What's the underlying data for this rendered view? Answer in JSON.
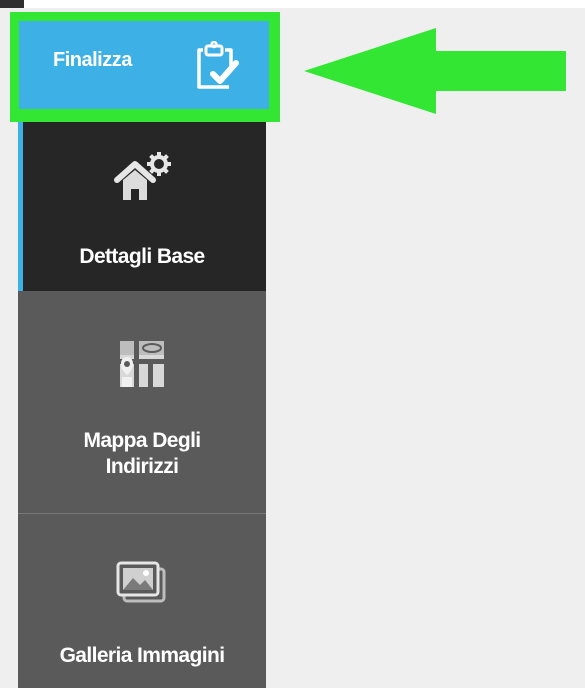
{
  "finalize": {
    "label": "Finalizza",
    "icon": "clipboard-check-icon"
  },
  "annotation": {
    "arrow_color": "#33e633",
    "highlight_color": "#33e633"
  },
  "sidebar": {
    "items": [
      {
        "label": "Dettagli Base",
        "icon": "house-gear-icon",
        "active": true
      },
      {
        "label_line1": "Mappa Degli",
        "label_line2": "Indirizzi",
        "icon": "map-pin-icon",
        "active": false
      },
      {
        "label": "Galleria Immagini",
        "icon": "image-gallery-icon",
        "active": false
      }
    ]
  },
  "colors": {
    "accent": "#3db0e6",
    "active_bg": "#262626",
    "sidebar_bg": "#5a5a5a"
  }
}
